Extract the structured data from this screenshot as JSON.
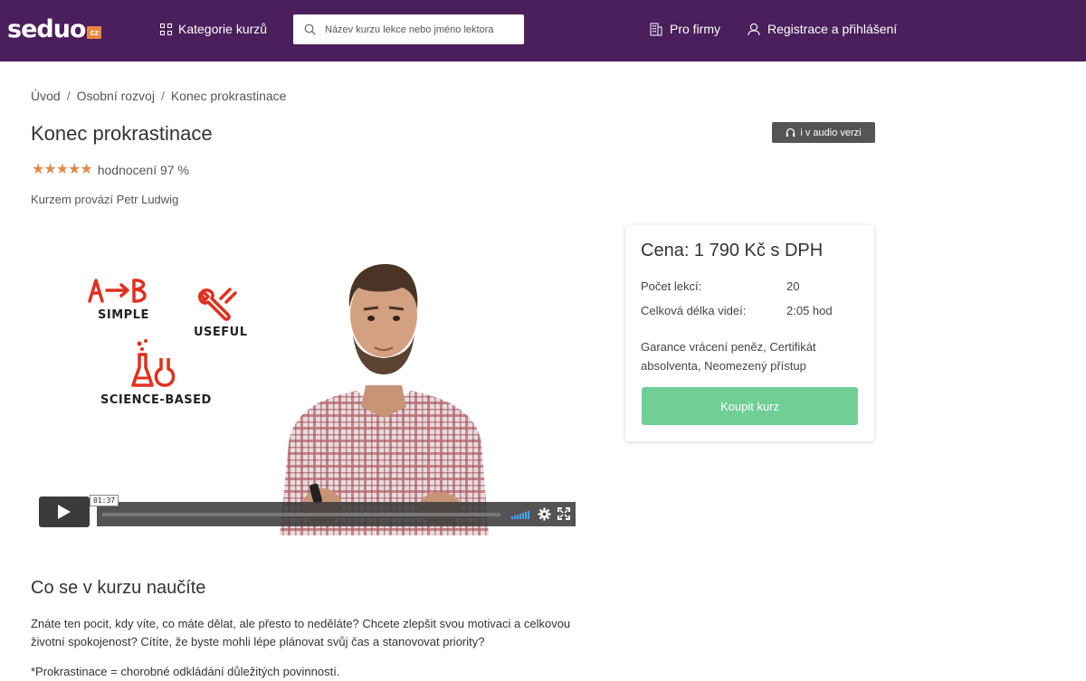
{
  "header": {
    "logo_text": "seduo",
    "logo_badge": "cz",
    "categories_label": "Kategorie kurzů",
    "search_placeholder": "Název kurzu lekce nebo jméno lektora",
    "firms_label": "Pro firmy",
    "register_label": "Registrace a přihlášení",
    "bg_color": "#4a1f5c"
  },
  "breadcrumb": {
    "items": [
      "Úvod",
      "Osobní rozvoj",
      "Konec prokrastinace"
    ],
    "separator": "/"
  },
  "course": {
    "title": "Konec prokrastinace",
    "audio_badge": "i v audio verzi",
    "stars": "★★★★★",
    "rating_text": "hodnocení 97 %",
    "rating_value": 5,
    "instructor_text": "Kurzem provází Petr Ludwig"
  },
  "video": {
    "doodle_labels": [
      "SIMPLE",
      "USEFUL",
      "SCIENCE-BASED"
    ],
    "ab_text": "A→B",
    "current_time": "01:37",
    "icons": [
      "play-icon",
      "volume-icon",
      "settings-icon",
      "fullscreen-icon"
    ]
  },
  "price_card": {
    "price": "Cena: 1 790 Kč s DPH",
    "lessons_label": "Počet lekcí:",
    "lessons_value": "20",
    "duration_label": "Celková délka videí:",
    "duration_value": "2:05 hod",
    "features": "Garance vrácení peněz, Certifikát absolventa, Neomezený přístup",
    "buy_label": "Koupit kurz",
    "buy_color": "#6fcf97"
  },
  "learn": {
    "title": "Co se v kurzu naučíte",
    "text": "Znáte ten pocit, kdy víte, co máte dělat, ale přesto to neděláte? Chcete zlepšit svou motivaci a celkovou životní spokojenost? Cítíte, že byste mohli lépe plánovat svůj čas a stanovovat priority?",
    "note": "*Prokrastinace = chorobné odkládání důležitých povinností."
  }
}
